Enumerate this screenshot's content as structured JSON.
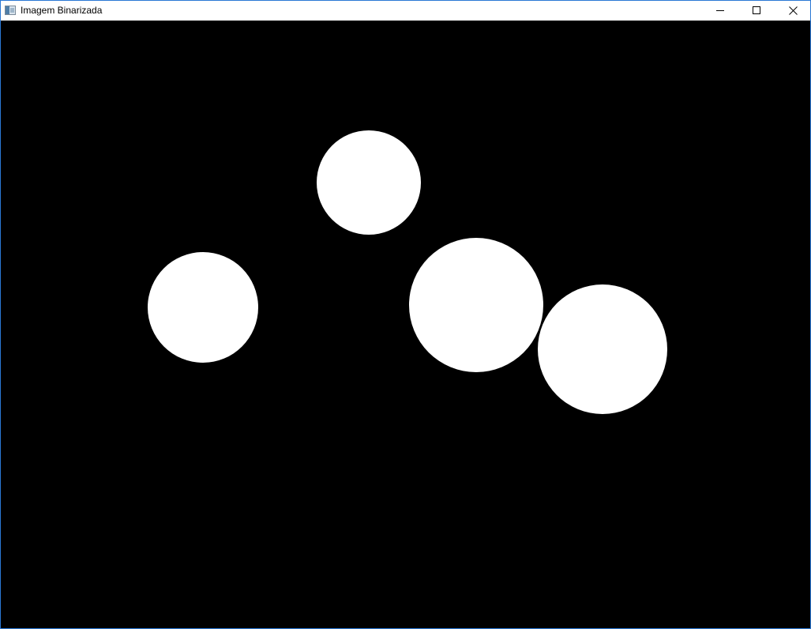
{
  "window": {
    "title": "Imagem Binarizada"
  },
  "caption_buttons": {
    "minimize": "minimize-icon",
    "maximize": "maximize-icon",
    "close": "close-icon"
  },
  "image": {
    "background_color": "#000000",
    "blob_color": "#ffffff"
  }
}
